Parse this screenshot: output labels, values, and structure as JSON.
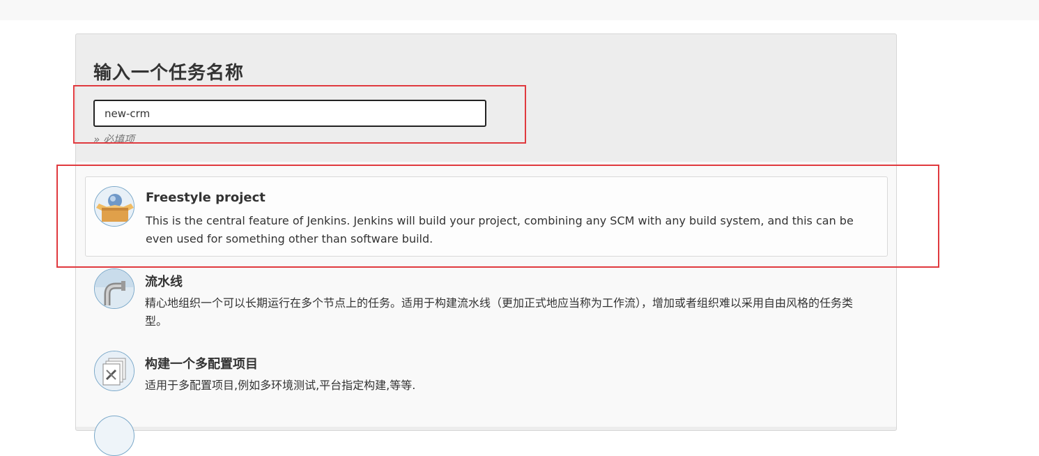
{
  "page": {
    "title": "输入一个任务名称",
    "name_input_value": "new-crm",
    "required_note": "» 必填项"
  },
  "item_types": [
    {
      "name": "Freestyle project",
      "description": "This is the central feature of Jenkins. Jenkins will build your project, combining any SCM with any build system, and this can be even used for something other than software build.",
      "icon": "freestyle-box-icon",
      "selected": true
    },
    {
      "name": "流水线",
      "description": "精心地组织一个可以长期运行在多个节点上的任务。适用于构建流水线（更加正式地应当称为工作流），增加或者组织难以采用自由风格的任务类型。",
      "icon": "pipeline-icon",
      "selected": false
    },
    {
      "name": "构建一个多配置项目",
      "description": "适用于多配置项目,例如多环境测试,平台指定构建,等等.",
      "icon": "multi-config-icon",
      "selected": false
    }
  ],
  "colors": {
    "highlight_box": "#e0393e",
    "panel_bg": "#ededed",
    "input_border": "#222222"
  }
}
